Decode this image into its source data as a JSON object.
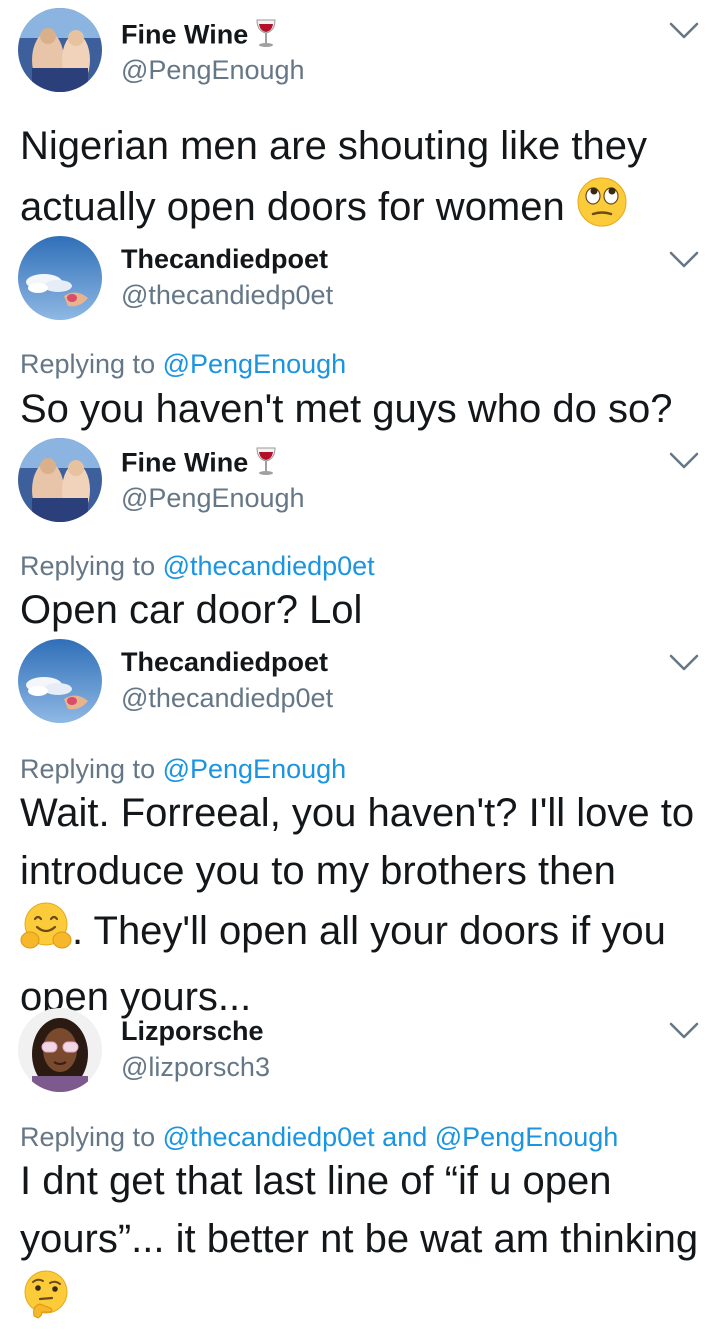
{
  "tweets": [
    {
      "name": "Fine Wine",
      "name_emoji": "wine-glass-emoji",
      "handle": "@PengEnough",
      "reply_prefix": "",
      "reply_to_1": "",
      "reply_and": "",
      "reply_to_2": "",
      "text_before": "Nigerian men are shouting like they actually open doors for women ",
      "text_emoji": "eye-roll-face-emoji",
      "text_after": ""
    },
    {
      "name": "Thecandiedpoet",
      "name_emoji": "",
      "handle": "@thecandiedp0et",
      "reply_prefix": "Replying to ",
      "reply_to_1": "@PengEnough",
      "reply_and": "",
      "reply_to_2": "",
      "text_before": "So you haven't met guys who do so?",
      "text_emoji": "",
      "text_after": ""
    },
    {
      "name": "Fine Wine",
      "name_emoji": "wine-glass-emoji",
      "handle": "@PengEnough",
      "reply_prefix": "Replying to ",
      "reply_to_1": "@thecandiedp0et",
      "reply_and": "",
      "reply_to_2": "",
      "text_before": "Open car door? Lol",
      "text_emoji": "",
      "text_after": ""
    },
    {
      "name": "Thecandiedpoet",
      "name_emoji": "",
      "handle": "@thecandiedp0et",
      "reply_prefix": "Replying to ",
      "reply_to_1": "@PengEnough",
      "reply_and": "",
      "reply_to_2": "",
      "text_before": "Wait. Forreeal, you haven't? I'll love to introduce you to my brothers then\n",
      "text_emoji": "hugging-face-emoji",
      "text_after": ". They'll open all your doors if you open yours..."
    },
    {
      "name": "Lizporsche",
      "name_emoji": "",
      "handle": "@lizporsch3",
      "reply_prefix": "Replying to ",
      "reply_to_1": "@thecandiedp0et",
      "reply_and": " and ",
      "reply_to_2": "@PengEnough",
      "text_before": "I dnt get that last line of “if u open yours”... it better nt be wat am thinking ",
      "text_emoji": "thinking-face-emoji",
      "text_after": ""
    }
  ],
  "colors": {
    "text": "#14171a",
    "secondary": "#657786",
    "link": "#1b95e0",
    "chevron": "#657786"
  }
}
